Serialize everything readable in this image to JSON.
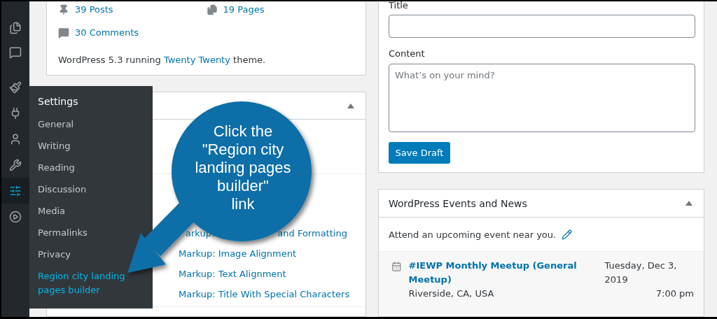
{
  "admin_menu": [
    {
      "kind": "pages",
      "selected": false
    },
    {
      "kind": "comments",
      "selected": false
    },
    {
      "kind": "appearance",
      "selected": false
    },
    {
      "kind": "plugins",
      "selected": false
    },
    {
      "kind": "users",
      "selected": false
    },
    {
      "kind": "tools",
      "selected": false
    },
    {
      "kind": "settings",
      "selected": true
    },
    {
      "kind": "media",
      "selected": false
    }
  ],
  "settings_flyout": {
    "title": "Settings",
    "items": [
      {
        "label": "General",
        "selected": false
      },
      {
        "label": "Writing",
        "selected": false
      },
      {
        "label": "Reading",
        "selected": false
      },
      {
        "label": "Discussion",
        "selected": false
      },
      {
        "label": "Media",
        "selected": false
      },
      {
        "label": "Permalinks",
        "selected": false
      },
      {
        "label": "Privacy",
        "selected": false
      },
      {
        "label": "Region city landing pages builder",
        "selected": true
      }
    ]
  },
  "at_a_glance": {
    "stats": [
      {
        "kind": "posts",
        "label": "39 Posts"
      },
      {
        "kind": "pages",
        "label": "19 Pages"
      },
      {
        "kind": "comments",
        "label": "30 Comments"
      }
    ],
    "version_prefix": "WordPress 5.3 running",
    "theme_link": "Twenty Twenty",
    "version_suffix": "theme."
  },
  "activity": {
    "expanded": true,
    "partial_post": [
      "arkup:",
      "and Formatting"
    ],
    "posts": [
      "Markup: Image Alignment",
      "Markup: Text Alignment",
      "Markup: Title With Special Characters"
    ]
  },
  "quick_draft": {
    "title_label": "Title",
    "content_label": "Content",
    "content_placeholder": "What’s on your mind?",
    "save_button": "Save Draft"
  },
  "events": {
    "title": "WordPress Events and News",
    "expanded": true,
    "intro": "Attend an upcoming event near you.",
    "items": [
      {
        "title": "#IEWP Monthly Meetup (General Meetup)",
        "location": "Riverside, CA, USA",
        "date": "Tuesday, Dec 3, 2019",
        "time": "7:00 pm"
      }
    ]
  },
  "callout": {
    "text": "Click the\n\"Region city\nlanding pages\nbuilder\"\nlink"
  }
}
